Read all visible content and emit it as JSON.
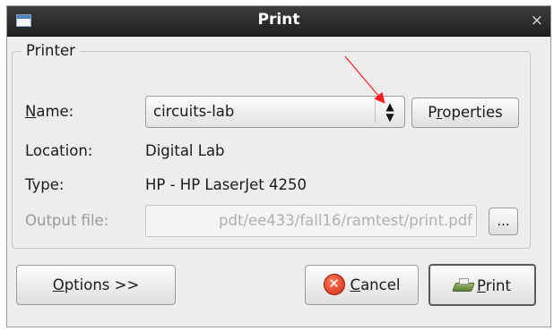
{
  "window": {
    "title": "Print",
    "close_glyph": "×"
  },
  "printer_section": {
    "legend": "Printer",
    "name_label_pre": "",
    "name_label_mnemonic": "N",
    "name_label_post": "ame:",
    "name_value": "circuits-lab",
    "combo_arrows": "▲▼",
    "properties_pre": "P",
    "properties_mnemonic": "r",
    "properties_post": "operties",
    "location_label": "Location:",
    "location_value": "Digital Lab",
    "type_label": "Type:",
    "type_value": "HP - HP LaserJet 4250",
    "output_label": "Output file:",
    "output_value": "pdt/ee433/fall16/ramtest/print.pdf",
    "browse_label": "..."
  },
  "buttons": {
    "options_mnemonic": "O",
    "options_rest": "ptions >>",
    "cancel_mnemonic": "C",
    "cancel_rest": "ancel",
    "print_mnemonic": "P",
    "print_rest": "rint"
  },
  "colors": {
    "annotation_arrow": "#ff1a1a"
  }
}
